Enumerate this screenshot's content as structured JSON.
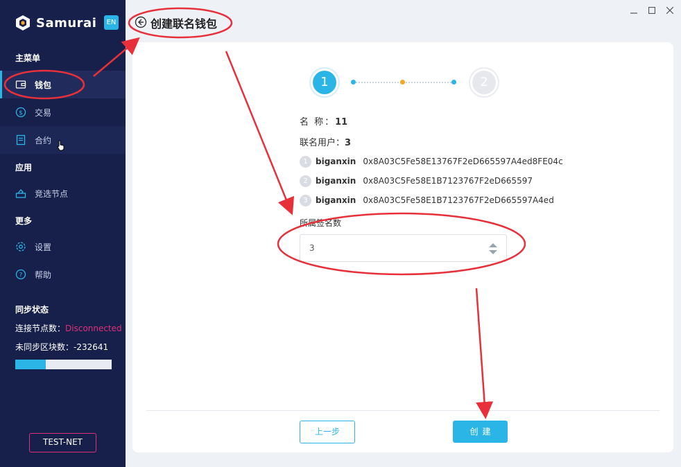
{
  "app": {
    "name": "Samurai",
    "lang": "EN"
  },
  "sidebar": {
    "main_menu_title": "主菜单",
    "items": [
      {
        "label": "钱包",
        "icon": "wallet-icon"
      },
      {
        "label": "交易",
        "icon": "dollar-icon"
      },
      {
        "label": "合约",
        "icon": "contract-icon"
      }
    ],
    "apps_title": "应用",
    "app_items": [
      {
        "label": "竞选节点",
        "icon": "vote-icon"
      }
    ],
    "more_title": "更多",
    "more_items": [
      {
        "label": "设置",
        "icon": "gear-icon"
      },
      {
        "label": "帮助",
        "icon": "help-icon"
      }
    ],
    "sync": {
      "title": "同步状态",
      "nodes_label": "连接节点数：",
      "nodes_value": "Disconnected",
      "unsynced_label": "未同步区块数：",
      "unsynced_value": "-232641",
      "progress": 0.32
    },
    "network": "TEST-NET"
  },
  "header": {
    "title": "创建联名钱包"
  },
  "stepper": {
    "step1": "1",
    "step2": "2",
    "current": 1
  },
  "wallet": {
    "name_label": "名 称：",
    "name_value": "11",
    "users_label": "联名用户：",
    "users_value": "3",
    "members": [
      {
        "no": "1",
        "name": "biganxin",
        "address": "0x8A03C5Fe58E13767F2eD665597A4ed8FE04c"
      },
      {
        "no": "2",
        "name": "biganxin",
        "address": "0x8A03C5Fe58E1B7123767F2eD665597"
      },
      {
        "no": "3",
        "name": "biganxin",
        "address": "0x8A03C5Fe58E1B7123767F2eD665597A4ed"
      }
    ],
    "signatures_label": "所属签名数",
    "signatures_value": "3"
  },
  "actions": {
    "prev": "上一步",
    "create": "创建"
  },
  "colors": {
    "accent": "#2bb5e6",
    "sidebar": "#16204a",
    "danger": "#e0307a",
    "annotation": "#e8303a"
  }
}
